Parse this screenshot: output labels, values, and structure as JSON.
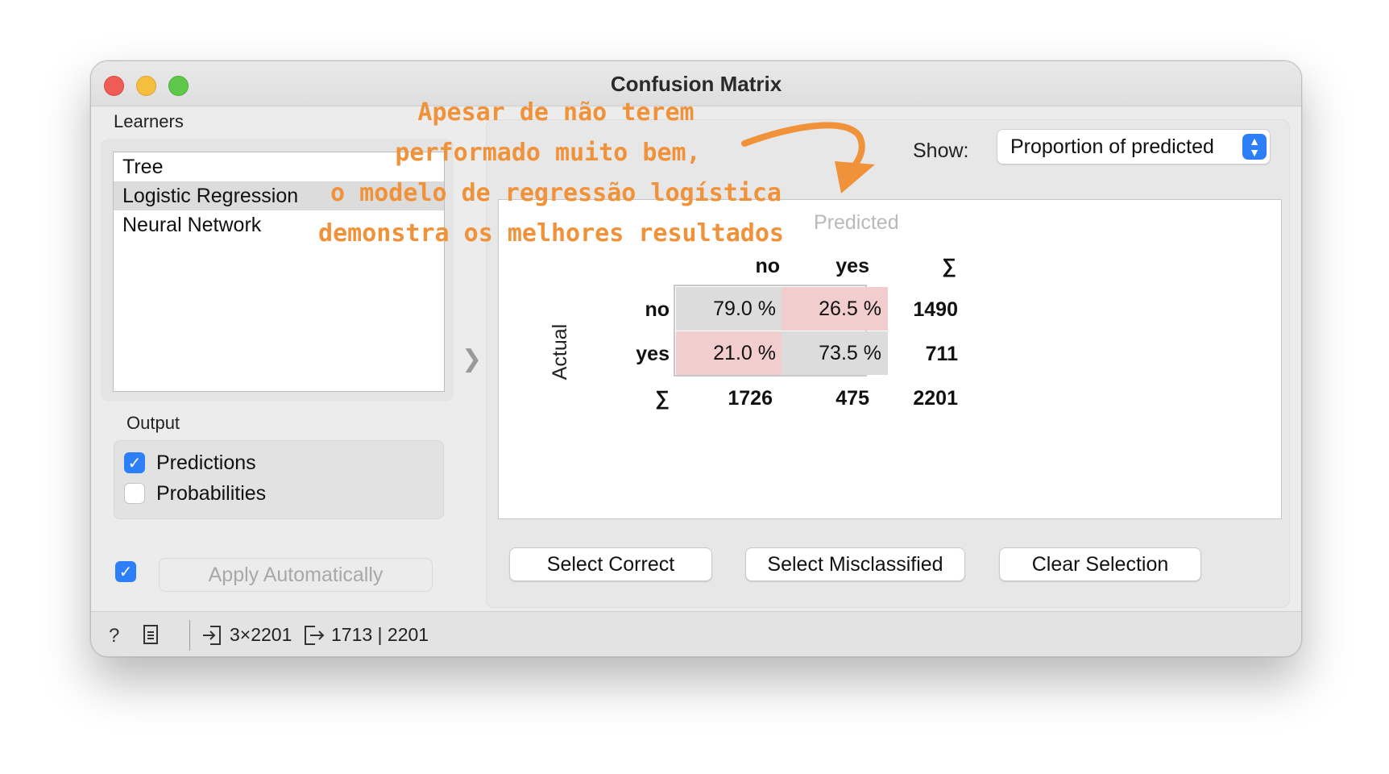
{
  "window": {
    "title": "Confusion Matrix"
  },
  "learners": {
    "label": "Learners",
    "items": [
      "Tree",
      "Logistic Regression",
      "Neural Network"
    ],
    "selected": "Logistic Regression"
  },
  "output": {
    "label": "Output",
    "predictions": {
      "label": "Predictions",
      "checked": true
    },
    "probabilities": {
      "label": "Probabilities",
      "checked": false
    }
  },
  "apply": {
    "checked": true,
    "label": "Apply Automatically"
  },
  "show": {
    "label": "Show:",
    "value": "Proportion of predicted"
  },
  "matrix": {
    "predicted_label": "Predicted",
    "actual_label": "Actual",
    "col_headers": [
      "no",
      "yes",
      "∑"
    ],
    "row_headers": [
      "no",
      "yes",
      "∑"
    ],
    "cells": [
      [
        "79.0 %",
        "26.5 %"
      ],
      [
        "21.0 %",
        "73.5 %"
      ]
    ],
    "row_totals": [
      "1490",
      "711"
    ],
    "col_totals": [
      "1726",
      "475"
    ],
    "grand_total": "2201"
  },
  "buttons": {
    "select_correct": "Select Correct",
    "select_misclassified": "Select Misclassified",
    "clear_selection": "Clear Selection"
  },
  "statusbar": {
    "input_summary": "3×2201",
    "output_summary": "1713 | 2201"
  },
  "annotation": {
    "lines": [
      "Apesar de não terem",
      "performado muito bem,",
      "o modelo de regressão logística",
      "demonstra os melhores resultados"
    ],
    "color": "#f0923a"
  }
}
